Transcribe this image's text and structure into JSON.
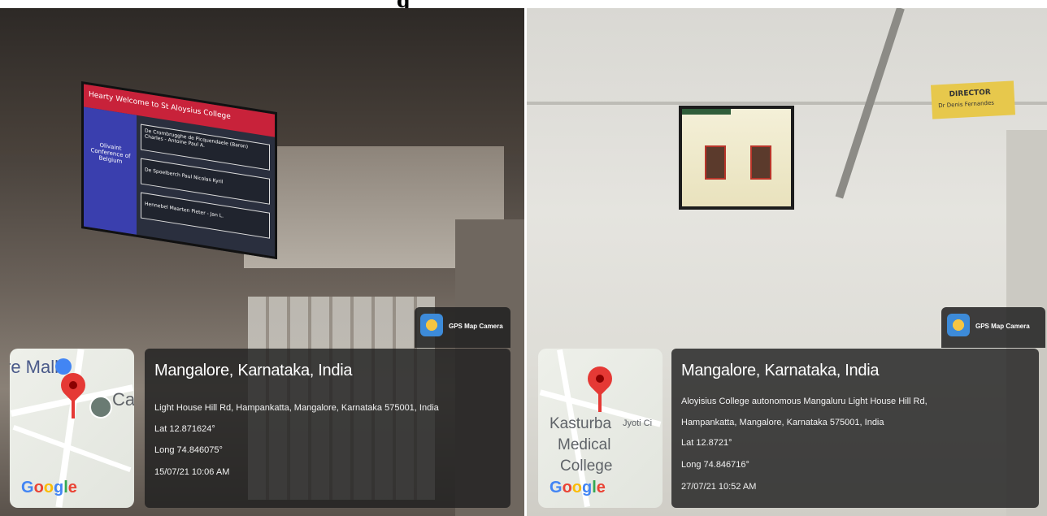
{
  "figure_title": "g",
  "photos": [
    {
      "app_badge": "GPS Map Camera",
      "map_labels": [
        "re Mall",
        "Ca"
      ],
      "map_logo": "Google",
      "place": "Mangalore, Karnataka, India",
      "address_lines": [
        "Light House Hill Rd, Hampankatta, Mangalore, Karnataka 575001, India"
      ],
      "lat": "Lat 12.871624°",
      "long": "Long 74.846075°",
      "datetime": "15/07/21 10:06 AM",
      "tv_header": "Hearty Welcome to St Aloysius College",
      "tv_side": "Olivaint Conference of Belgium",
      "tv_rows": [
        "De Crombrugghe de Picquendaele (Baron) Charles - Antoine Paul A.",
        "De Spoelberch Paul Nicolas Kyril",
        "Hennebel Maarten Pieter - Jan L."
      ]
    },
    {
      "app_badge": "GPS Map Camera",
      "map_labels": [
        "Kasturba",
        "Medical",
        "College",
        "Jyoti Ci"
      ],
      "map_logo": "Google",
      "place": "Mangalore, Karnataka, India",
      "address_lines": [
        "Aloyisius College autonomous Mangaluru Light House Hill Rd,",
        "Hampankatta, Mangalore, Karnataka 575001, India"
      ],
      "lat": "Lat 12.8721°",
      "long": "Long 74.846716°",
      "datetime": "27/07/21 10:52 AM",
      "sign_text": [
        "DIRECTOR",
        "Dr Denis Fernandes"
      ]
    }
  ],
  "colors": {
    "overlay": "#202020",
    "pin": "#e53935",
    "tv_header": "#c8223a",
    "tv_side": "#3a3fae",
    "sign": "#e7c84c"
  },
  "icons": [
    "map-pin-icon",
    "gps-camera-app-icon",
    "graduation-cap-icon"
  ]
}
